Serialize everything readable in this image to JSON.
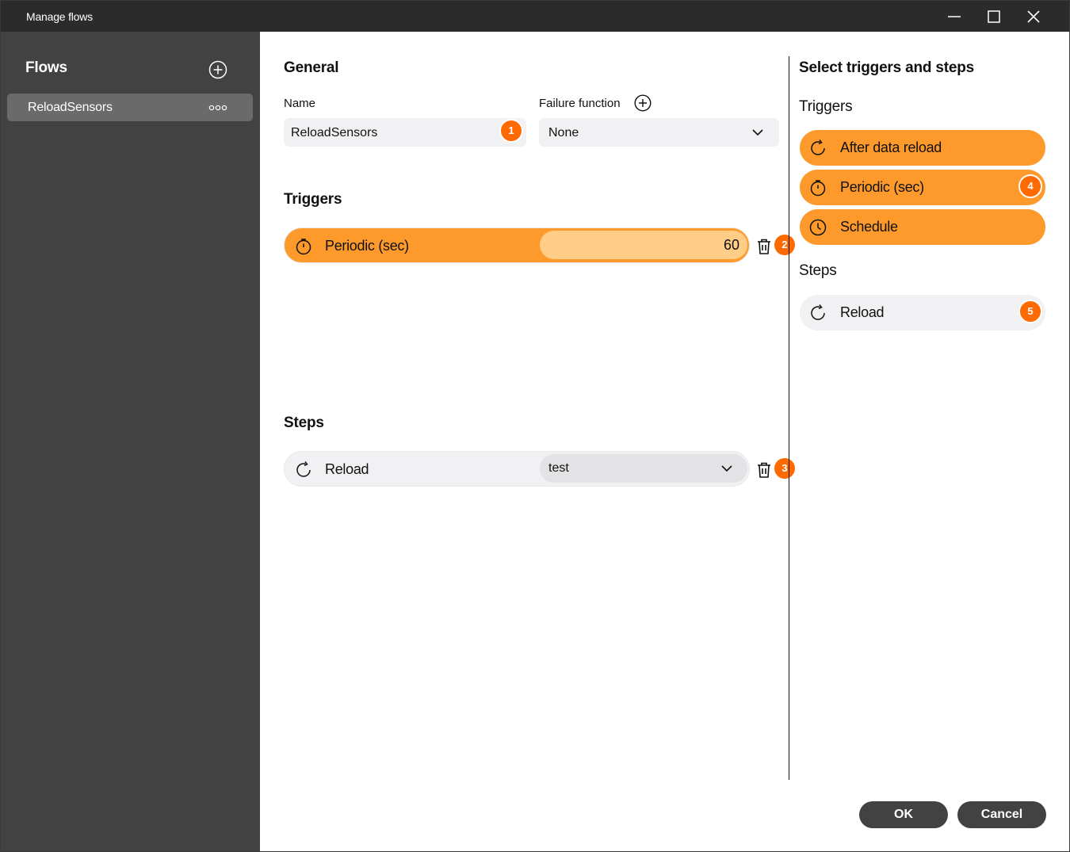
{
  "window": {
    "title": "Manage flows"
  },
  "sidebar": {
    "heading": "Flows",
    "flows": [
      {
        "name": "ReloadSensors"
      }
    ]
  },
  "general": {
    "heading": "General",
    "name_label": "Name",
    "name_value": "ReloadSensors",
    "failure_label": "Failure function",
    "failure_value": "None"
  },
  "triggers": {
    "heading": "Triggers",
    "items": [
      {
        "label": "Periodic (sec)",
        "value": "60"
      }
    ]
  },
  "steps": {
    "heading": "Steps",
    "items": [
      {
        "label": "Reload",
        "selected": "test"
      }
    ]
  },
  "palette": {
    "heading": "Select triggers and steps",
    "triggers_heading": "Triggers",
    "triggers": [
      {
        "label": "After data reload",
        "icon": "refresh-icon"
      },
      {
        "label": "Periodic (sec)",
        "icon": "timer-icon"
      },
      {
        "label": "Schedule",
        "icon": "clock-icon"
      }
    ],
    "steps_heading": "Steps",
    "steps": [
      {
        "label": "Reload",
        "icon": "refresh-icon"
      }
    ]
  },
  "badges": [
    "1",
    "2",
    "3",
    "4",
    "5"
  ],
  "footer": {
    "ok": "OK",
    "cancel": "Cancel"
  },
  "colors": {
    "accent": "#fd9a2b",
    "accent_light": "#ffcd86",
    "badge": "#ff6a00",
    "sidebar": "#424242",
    "titlebar": "#2b2b2b"
  }
}
